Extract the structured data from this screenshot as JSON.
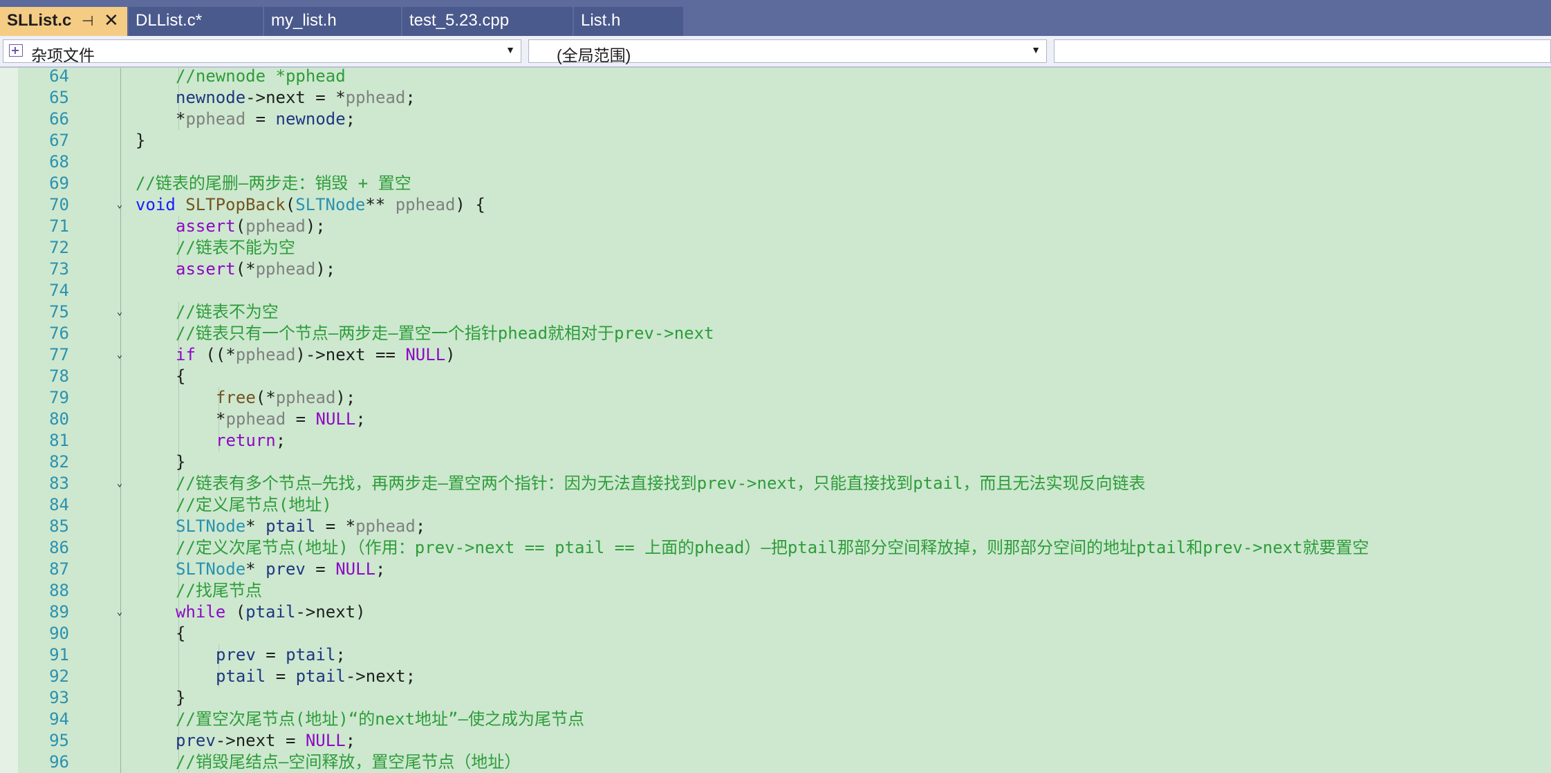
{
  "tabs": [
    {
      "label": "SLList.c",
      "active": true,
      "pin_icon": "pin-icon",
      "close_icon": "close-icon"
    },
    {
      "label": "DLList.c*",
      "active": false
    },
    {
      "label": "my_list.h",
      "active": false
    },
    {
      "label": "test_5.23.cpp",
      "active": false
    },
    {
      "label": "List.h",
      "active": false
    }
  ],
  "navbar": {
    "project_combo": "杂项文件",
    "scope_combo": "(全局范围)",
    "member_combo": ""
  },
  "colors": {
    "editor_bg": "#cde8cf",
    "tabbar_bg": "#5c6a9c",
    "active_tab": "#f5cc84",
    "comment": "#2e9c3a",
    "keyword": "#1a1aff",
    "type": "#2b91af",
    "line_number": "#2b91af"
  },
  "editor": {
    "lines": [
      {
        "n": "64",
        "indent": 1,
        "fold": "",
        "toks": [
          [
            "cm",
            "//newnode *pphead"
          ]
        ]
      },
      {
        "n": "65",
        "indent": 1,
        "fold": "",
        "toks": [
          [
            "id",
            "newnode"
          ],
          [
            "pl",
            "->"
          ],
          [
            "fld",
            "next"
          ],
          [
            "pl",
            " = *"
          ],
          [
            "par",
            "pphead"
          ],
          [
            "pl",
            ";"
          ]
        ]
      },
      {
        "n": "66",
        "indent": 1,
        "fold": "",
        "toks": [
          [
            "pl",
            "*"
          ],
          [
            "par",
            "pphead"
          ],
          [
            "pl",
            " = "
          ],
          [
            "id",
            "newnode"
          ],
          [
            "pl",
            ";"
          ]
        ]
      },
      {
        "n": "67",
        "indent": 0,
        "fold": "",
        "toks": [
          [
            "pl",
            "}"
          ]
        ]
      },
      {
        "n": "68",
        "indent": 0,
        "fold": "",
        "toks": []
      },
      {
        "n": "69",
        "indent": 0,
        "fold": "",
        "toks": [
          [
            "cm",
            "//链表的尾删—两步走：销毁 + 置空"
          ]
        ]
      },
      {
        "n": "70",
        "indent": 0,
        "fold": "v",
        "toks": [
          [
            "kw",
            "void"
          ],
          [
            "pl",
            " "
          ],
          [
            "fn",
            "SLTPopBack"
          ],
          [
            "pl",
            "("
          ],
          [
            "ty",
            "SLTNode"
          ],
          [
            "pl",
            "** "
          ],
          [
            "par",
            "pphead"
          ],
          [
            "pl",
            ") {"
          ]
        ]
      },
      {
        "n": "71",
        "indent": 1,
        "fold": "",
        "toks": [
          [
            "mac",
            "assert"
          ],
          [
            "pl",
            "("
          ],
          [
            "par",
            "pphead"
          ],
          [
            "pl",
            ");"
          ]
        ]
      },
      {
        "n": "72",
        "indent": 1,
        "fold": "",
        "toks": [
          [
            "cm",
            "//链表不能为空"
          ]
        ]
      },
      {
        "n": "73",
        "indent": 1,
        "fold": "",
        "toks": [
          [
            "mac",
            "assert"
          ],
          [
            "pl",
            "(*"
          ],
          [
            "par",
            "pphead"
          ],
          [
            "pl",
            ");"
          ]
        ]
      },
      {
        "n": "74",
        "indent": 0,
        "fold": "",
        "toks": []
      },
      {
        "n": "75",
        "indent": 1,
        "fold": "v",
        "toks": [
          [
            "cm",
            "//链表不为空"
          ]
        ]
      },
      {
        "n": "76",
        "indent": 1,
        "fold": "",
        "toks": [
          [
            "cm",
            "//链表只有一个节点—两步走—置空一个指针phead就相对于prev->next"
          ]
        ]
      },
      {
        "n": "77",
        "indent": 1,
        "fold": "v",
        "toks": [
          [
            "ctl",
            "if"
          ],
          [
            "pl",
            " ((*"
          ],
          [
            "par",
            "pphead"
          ],
          [
            "pl",
            ")->"
          ],
          [
            "fld",
            "next"
          ],
          [
            "pl",
            " == "
          ],
          [
            "mac",
            "NULL"
          ],
          [
            "pl",
            ")"
          ]
        ]
      },
      {
        "n": "78",
        "indent": 1,
        "fold": "",
        "toks": [
          [
            "pl",
            "{"
          ]
        ]
      },
      {
        "n": "79",
        "indent": 2,
        "fold": "",
        "toks": [
          [
            "fn",
            "free"
          ],
          [
            "pl",
            "(*"
          ],
          [
            "par",
            "pphead"
          ],
          [
            "pl",
            ");"
          ]
        ]
      },
      {
        "n": "80",
        "indent": 2,
        "fold": "",
        "toks": [
          [
            "pl",
            "*"
          ],
          [
            "par",
            "pphead"
          ],
          [
            "pl",
            " = "
          ],
          [
            "mac",
            "NULL"
          ],
          [
            "pl",
            ";"
          ]
        ]
      },
      {
        "n": "81",
        "indent": 2,
        "fold": "",
        "toks": [
          [
            "ctl",
            "return"
          ],
          [
            "pl",
            ";"
          ]
        ]
      },
      {
        "n": "82",
        "indent": 1,
        "fold": "",
        "toks": [
          [
            "pl",
            "}"
          ]
        ]
      },
      {
        "n": "83",
        "indent": 1,
        "fold": "v",
        "toks": [
          [
            "cm",
            "//链表有多个节点—先找，再两步走—置空两个指针：因为无法直接找到prev->next，只能直接找到ptail，而且无法实现反向链表"
          ]
        ]
      },
      {
        "n": "84",
        "indent": 1,
        "fold": "",
        "toks": [
          [
            "cm",
            "//定义尾节点(地址)"
          ]
        ]
      },
      {
        "n": "85",
        "indent": 1,
        "fold": "",
        "toks": [
          [
            "ty",
            "SLTNode"
          ],
          [
            "pl",
            "* "
          ],
          [
            "id",
            "ptail"
          ],
          [
            "pl",
            " = *"
          ],
          [
            "par",
            "pphead"
          ],
          [
            "pl",
            ";"
          ]
        ]
      },
      {
        "n": "86",
        "indent": 1,
        "fold": "",
        "toks": [
          [
            "cm",
            "//定义次尾节点(地址)（作用：prev->next == ptail == 上面的phead）—把ptail那部分空间释放掉，则那部分空间的地址ptail和prev->next就要置空"
          ]
        ]
      },
      {
        "n": "87",
        "indent": 1,
        "fold": "",
        "toks": [
          [
            "ty",
            "SLTNode"
          ],
          [
            "pl",
            "* "
          ],
          [
            "id",
            "prev"
          ],
          [
            "pl",
            " = "
          ],
          [
            "mac",
            "NULL"
          ],
          [
            "pl",
            ";"
          ]
        ]
      },
      {
        "n": "88",
        "indent": 1,
        "fold": "",
        "toks": [
          [
            "cm",
            "//找尾节点"
          ]
        ]
      },
      {
        "n": "89",
        "indent": 1,
        "fold": "v",
        "toks": [
          [
            "ctl",
            "while"
          ],
          [
            "pl",
            " ("
          ],
          [
            "id",
            "ptail"
          ],
          [
            "pl",
            "->"
          ],
          [
            "fld",
            "next"
          ],
          [
            "pl",
            ")"
          ]
        ]
      },
      {
        "n": "90",
        "indent": 1,
        "fold": "",
        "toks": [
          [
            "pl",
            "{"
          ]
        ]
      },
      {
        "n": "91",
        "indent": 2,
        "fold": "",
        "toks": [
          [
            "id",
            "prev"
          ],
          [
            "pl",
            " = "
          ],
          [
            "id",
            "ptail"
          ],
          [
            "pl",
            ";"
          ]
        ]
      },
      {
        "n": "92",
        "indent": 2,
        "fold": "",
        "toks": [
          [
            "id",
            "ptail"
          ],
          [
            "pl",
            " = "
          ],
          [
            "id",
            "ptail"
          ],
          [
            "pl",
            "->"
          ],
          [
            "fld",
            "next"
          ],
          [
            "pl",
            ";"
          ]
        ]
      },
      {
        "n": "93",
        "indent": 1,
        "fold": "",
        "toks": [
          [
            "pl",
            "}"
          ]
        ]
      },
      {
        "n": "94",
        "indent": 1,
        "fold": "",
        "toks": [
          [
            "cm",
            "//置空次尾节点(地址)“的next地址”—使之成为尾节点"
          ]
        ]
      },
      {
        "n": "95",
        "indent": 1,
        "fold": "",
        "toks": [
          [
            "id",
            "prev"
          ],
          [
            "pl",
            "->"
          ],
          [
            "fld",
            "next"
          ],
          [
            "pl",
            " = "
          ],
          [
            "mac",
            "NULL"
          ],
          [
            "pl",
            ";"
          ]
        ]
      },
      {
        "n": "96",
        "indent": 1,
        "fold": "",
        "toks": [
          [
            "cm",
            "//销毁尾结点—空间释放，置空尾节点（地址）"
          ]
        ]
      }
    ]
  }
}
